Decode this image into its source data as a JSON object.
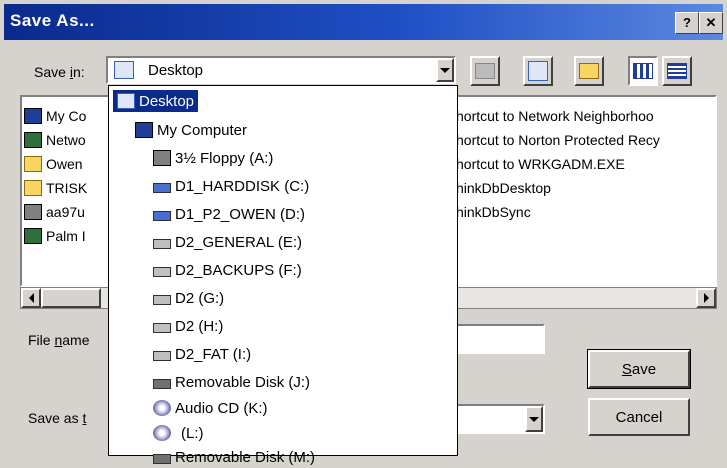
{
  "window": {
    "title": "Save As...",
    "help_label": "?",
    "close_label": "✕"
  },
  "save_in": {
    "label_prefix": "Save ",
    "label_access": "i",
    "label_suffix": "n:",
    "value": "Desktop"
  },
  "toolbar": {
    "icons": [
      "up-one-level-icon",
      "desktop-icon",
      "new-folder-icon",
      "list-view-icon",
      "details-view-icon"
    ]
  },
  "files": {
    "left": [
      {
        "label": "My Co",
        "icon": "computer-icon"
      },
      {
        "label": "Netwo",
        "icon": "network-icon"
      },
      {
        "label": "Owen",
        "icon": "folder-icon"
      },
      {
        "label": "TRISK",
        "icon": "folder-icon"
      },
      {
        "label": "aa97u",
        "icon": "file-icon"
      },
      {
        "label": "Palm I",
        "icon": "palm-icon"
      }
    ],
    "right": [
      {
        "label": "hortcut to Network Neighborhoo"
      },
      {
        "label": "hortcut to Norton Protected Recy"
      },
      {
        "label": "hortcut to WRKGADM.EXE"
      },
      {
        "label": "hinkDbDesktop"
      },
      {
        "label": "hinkDbSync"
      }
    ]
  },
  "dropdown": {
    "items": [
      {
        "label": "Desktop",
        "icon": "desktop-icon",
        "indent": 0,
        "selected": true
      },
      {
        "label": "My Computer",
        "icon": "computer-icon",
        "indent": 1
      },
      {
        "label": "3½ Floppy (A:)",
        "icon": "floppy-icon",
        "indent": 2
      },
      {
        "label": "D1_HARDDISK (C:)",
        "icon": "hard-drive-icon",
        "indent": 2
      },
      {
        "label": "D1_P2_OWEN (D:)",
        "icon": "hard-drive-icon",
        "indent": 2
      },
      {
        "label": "D2_GENERAL (E:)",
        "icon": "hard-drive-icon",
        "indent": 2
      },
      {
        "label": "D2_BACKUPS (F:)",
        "icon": "hard-drive-icon",
        "indent": 2
      },
      {
        "label": "D2 (G:)",
        "icon": "hard-drive-icon",
        "indent": 2
      },
      {
        "label": "D2 (H:)",
        "icon": "hard-drive-icon",
        "indent": 2
      },
      {
        "label": "D2_FAT (I:)",
        "icon": "hard-drive-icon",
        "indent": 2
      },
      {
        "label": "Removable Disk (J:)",
        "icon": "removable-disk-icon",
        "indent": 2
      },
      {
        "label": "Audio CD (K:)",
        "icon": "cd-icon",
        "indent": 2
      },
      {
        "label": "(L:)",
        "icon": "cd-icon",
        "indent": 2
      },
      {
        "label": "Removable Disk (M:)",
        "icon": "removable-disk-icon",
        "indent": 2
      }
    ]
  },
  "filename": {
    "label_prefix": "File ",
    "label_access": "n",
    "label_suffix": "ame",
    "value": ""
  },
  "saveastype": {
    "label_prefix": "Save as ",
    "label_access": "t",
    "value": ""
  },
  "buttons": {
    "save_access": "S",
    "save_rest": "ave",
    "cancel": "Cancel"
  },
  "colors": {
    "title_bar": "#0a2a8c",
    "selection": "#0a2a8c",
    "face": "#d6d3ce"
  }
}
